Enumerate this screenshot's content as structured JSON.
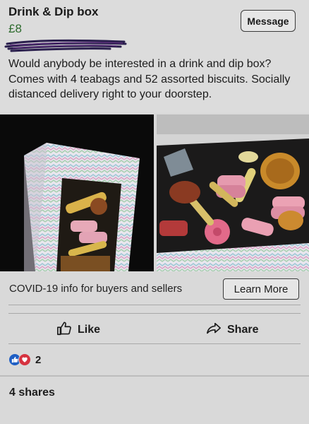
{
  "listing": {
    "title": "Drink & Dip box",
    "price": "£8",
    "message_label": "Message",
    "description": "Would anybody be interested in a drink and dip box? Comes with 4 teabags and 52 assorted biscuits. Socially distanced delivery right to your doorstep."
  },
  "covid": {
    "text": "COVID-19 info for buyers and sellers",
    "learn_more_label": "Learn More"
  },
  "actions": {
    "like_label": "Like",
    "share_label": "Share"
  },
  "reactions": {
    "count": "2",
    "icons": [
      "thumbs-up-icon",
      "heart-icon"
    ]
  },
  "shares": {
    "label": "4 shares"
  },
  "colors": {
    "price": "#2e6b2e",
    "like_reaction": "#1f5fc4",
    "love_reaction": "#d63340",
    "background": "#d9d9d9"
  }
}
